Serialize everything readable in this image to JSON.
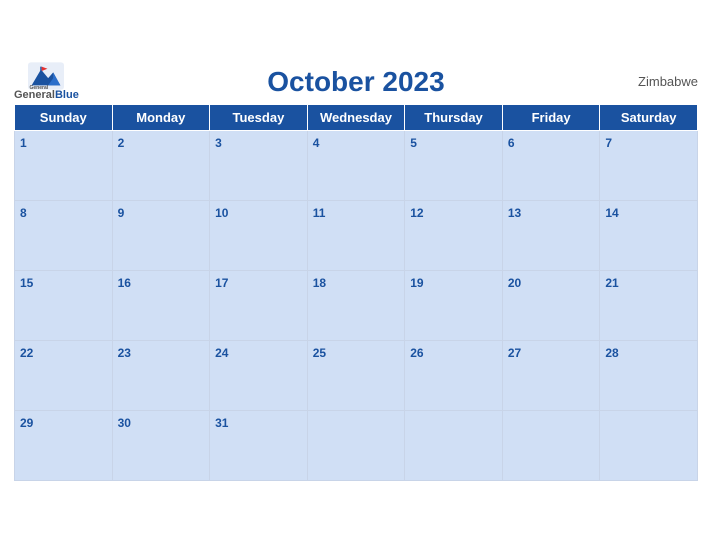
{
  "header": {
    "logo_general": "General",
    "logo_blue": "Blue",
    "month_year": "October 2023",
    "country": "Zimbabwe"
  },
  "weekdays": [
    "Sunday",
    "Monday",
    "Tuesday",
    "Wednesday",
    "Thursday",
    "Friday",
    "Saturday"
  ],
  "weeks": [
    [
      1,
      2,
      3,
      4,
      5,
      6,
      7
    ],
    [
      8,
      9,
      10,
      11,
      12,
      13,
      14
    ],
    [
      15,
      16,
      17,
      18,
      19,
      20,
      21
    ],
    [
      22,
      23,
      24,
      25,
      26,
      27,
      28
    ],
    [
      29,
      30,
      31,
      null,
      null,
      null,
      null
    ]
  ]
}
